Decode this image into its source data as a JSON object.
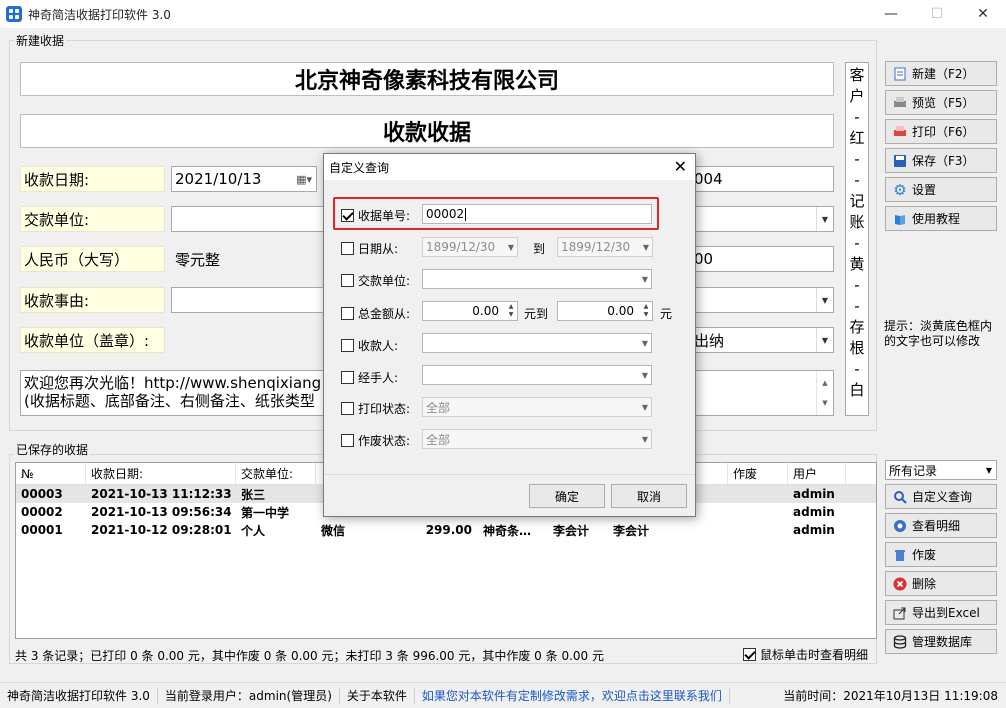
{
  "window": {
    "title": "神奇简洁收据打印软件 3.0",
    "min": "—",
    "max": "☐",
    "close": "✕"
  },
  "new_receipt": {
    "group_label": "新建收据",
    "company": "北京神奇像素科技有限公司",
    "doc_title": "收款收据",
    "date_label": "收款日期:",
    "date_value": "2021/10/13",
    "number_partial": "004",
    "payer_label": "交款单位:",
    "rmb_label": "人民币（大写）",
    "rmb_value": "零元整",
    "amount_partial": "00",
    "reason_label": "收款事由:",
    "seal_label": "收款单位（盖章）:",
    "cashier_partial": "出纳",
    "note_line1": "欢迎您再次光临！http://www.shenqixiang",
    "note_line2": "(收据标题、底部备注、右侧备注、纸张类型",
    "side_note": [
      "客",
      "户",
      "-",
      "红",
      "-",
      "-",
      "记",
      "账",
      "-",
      "黄",
      "-",
      "-",
      "存",
      "根",
      "-",
      "白"
    ]
  },
  "right_buttons": [
    {
      "label": "新建（F2）",
      "icon": "new-icon"
    },
    {
      "label": "预览（F5）",
      "icon": "preview-icon"
    },
    {
      "label": "打印（F6）",
      "icon": "print-icon"
    },
    {
      "label": "保存（F3）",
      "icon": "save-icon"
    },
    {
      "label": "设置",
      "icon": "gear-icon"
    },
    {
      "label": "使用教程",
      "icon": "book-icon"
    }
  ],
  "hint": "提示：淡黄底色框内的文字也可以修改",
  "saved": {
    "group_label": "已保存的收据",
    "filter_value": "所有记录",
    "columns": [
      "№",
      "收款日期:",
      "交款单位:",
      "",
      "",
      "",
      "",
      "",
      "作废",
      "用户"
    ],
    "rows": [
      [
        "00003",
        "2021-10-13 11:12:33",
        "张三",
        "",
        "",
        "",
        "",
        "",
        "",
        "admin"
      ],
      [
        "00002",
        "2021-10-13 09:56:34",
        "第一中学",
        "",
        "",
        "",
        "",
        "",
        "",
        "admin"
      ],
      [
        "00001",
        "2021-10-12 09:28:01",
        "个人",
        "微信",
        "299.00",
        "神奇条…",
        "李会计",
        "李会计",
        "",
        "admin"
      ]
    ],
    "summary": "共 3 条记录；已打印 0 条 0.00 元，其中作废 0 条 0.00 元；未打印 3 条 996.00 元，其中作废 0 条 0.00 元",
    "click_view": "鼠标单击时查看明细"
  },
  "side_actions": [
    {
      "label": "自定义查询",
      "icon": "search-icon"
    },
    {
      "label": "查看明细",
      "icon": "view-icon"
    },
    {
      "label": "作废",
      "icon": "trash-icon"
    },
    {
      "label": "删除",
      "icon": "delete-icon"
    },
    {
      "label": "导出到Excel",
      "icon": "export-icon"
    },
    {
      "label": "管理数据库",
      "icon": "database-icon"
    }
  ],
  "statusbar": {
    "app": "神奇简洁收据打印软件 3.0",
    "user": "当前登录用户：admin(管理员)",
    "about": "关于本软件",
    "link": "如果您对本软件有定制修改需求，欢迎点击这里联系我们",
    "time": "当前时间：2021年10月13日 11:19:08"
  },
  "dialog": {
    "title": "自定义查询",
    "receipt_no_label": "收据单号:",
    "receipt_no_value": "00002",
    "date_from_label": "日期从:",
    "date_from": "1899/12/30",
    "to_label": "到",
    "date_to": "1899/12/30",
    "payer_label": "交款单位:",
    "amount_from_label": "总金额从:",
    "amount_from": "0.00",
    "amount_to_label": "元到",
    "amount_to": "0.00",
    "yuan": "元",
    "receiver_label": "收款人:",
    "handler_label": "经手人:",
    "print_status_label": "打印状态:",
    "print_status_value": "全部",
    "void_status_label": "作废状态:",
    "void_status_value": "全部",
    "ok": "确定",
    "cancel": "取消"
  },
  "colors": {
    "accent_red": "#e0262b",
    "label_bg": "#ffffe1",
    "link": "#1a57c7"
  }
}
